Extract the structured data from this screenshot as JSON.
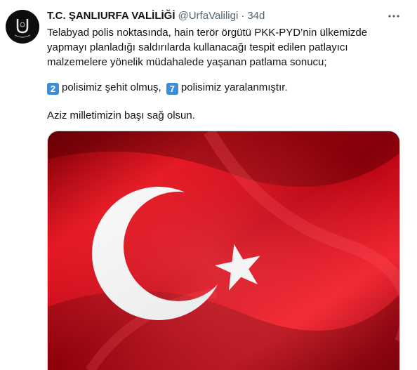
{
  "tweet": {
    "display_name": "T.C. ŞANLIURFA VALİLİĞİ",
    "handle": "@UrfaValiligi",
    "separator": "·",
    "time": "34d",
    "text_lines": [
      "Telabyad polis noktasında, hain terör örgütü PKK-PYD’nin ülkemizde",
      "yapmayı planladığı saldırılarda kullanacağı tespit edilen patlayıcı",
      "malzemelere yönelik müdahalede yaşanan patlama sonucu;"
    ],
    "casualty": {
      "martyr_count": "2",
      "martyr_text": "polisimiz şehit olmuş,",
      "wounded_count": "7",
      "wounded_text": "polisimiz yaralanmıştır."
    },
    "closing_text": "Aziz milletimizin başı sağ olsun."
  },
  "icons": {
    "more": "more-horizontal-icon",
    "avatar": "government-emblem-icon",
    "media": "turkish-flag-image"
  },
  "colors": {
    "text": "#0f1419",
    "muted": "#536471",
    "flag_red": "#d90c1a",
    "keycap_blue": "#3b8fd9"
  }
}
